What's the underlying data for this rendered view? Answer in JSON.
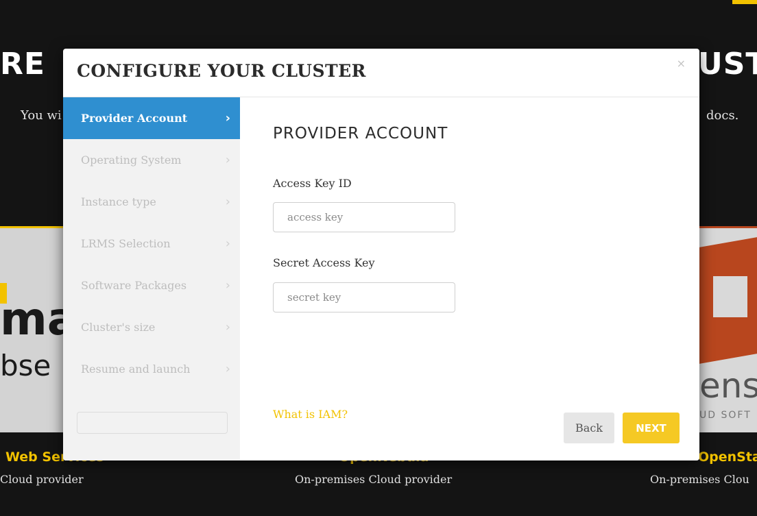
{
  "background": {
    "heading_left": "RE",
    "heading_right": "UST",
    "sub_left": "You wi",
    "sub_right": "docs.",
    "logos": {
      "aws_line1": "ma",
      "aws_line2": "bse",
      "openstack_line1": "ens",
      "openstack_line2": "UD SOFT"
    },
    "providers": [
      {
        "title": "Web Services",
        "desc": "Cloud provider"
      },
      {
        "title": "OpenNebula",
        "desc": "On-premises Cloud provider"
      },
      {
        "title": "OpenSta",
        "desc": "On-premises Clou"
      }
    ],
    "colors": {
      "accent": "#f2c200",
      "page_bg": "#141414"
    }
  },
  "modal": {
    "title": "CONFIGURE YOUR CLUSTER",
    "close_glyph": "×",
    "steps": [
      {
        "label": "Provider Account",
        "active": true
      },
      {
        "label": "Operating System",
        "active": false
      },
      {
        "label": "Instance type",
        "active": false
      },
      {
        "label": "LRMS Selection",
        "active": false
      },
      {
        "label": "Software Packages",
        "active": false
      },
      {
        "label": "Cluster's size",
        "active": false
      },
      {
        "label": "Resume and launch",
        "active": false
      }
    ],
    "chevron_glyph": "›",
    "content": {
      "title": "PROVIDER ACCOUNT",
      "access_key_label": "Access Key ID",
      "access_key_placeholder": "access key",
      "access_key_value": "",
      "secret_key_label": "Secret Access Key",
      "secret_key_placeholder": "secret key",
      "secret_key_value": "",
      "iam_link": "What is IAM?"
    },
    "buttons": {
      "back": "Back",
      "next": "NEXT"
    },
    "colors": {
      "active_step": "#2f8fd0",
      "next_button": "#f5c924",
      "link": "#f2c200"
    }
  }
}
